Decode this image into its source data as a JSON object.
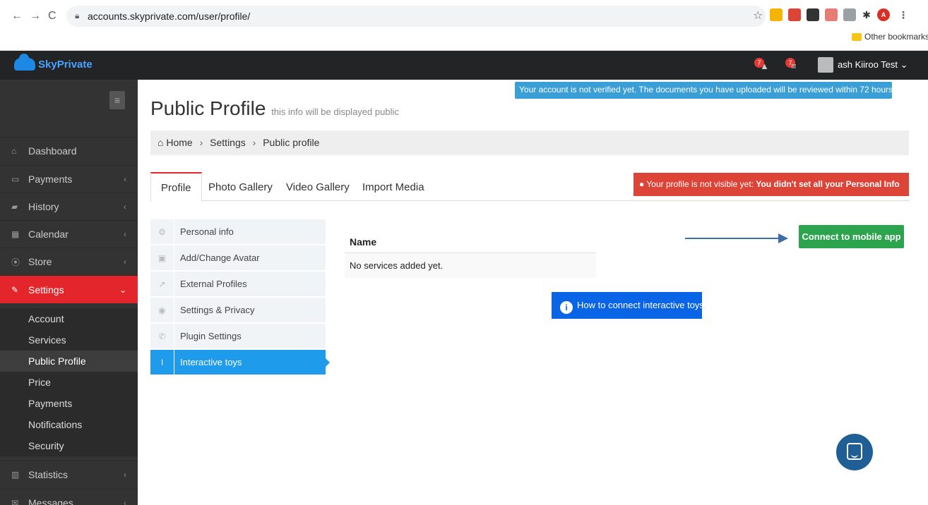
{
  "browser": {
    "back": "←",
    "forward": "→",
    "reload": "C",
    "url": "accounts.skyprivate.com/user/profile/",
    "bookmark_folder": "Other bookmarks",
    "profile_initial": "A"
  },
  "header": {
    "brand": "SkyPrivate",
    "notif1_count": "7",
    "notif2_count": "7",
    "user_name": "ash Kiiroo Test"
  },
  "sidebar": {
    "items": [
      {
        "label": "Dashboard",
        "icon": "home-icon"
      },
      {
        "label": "Payments",
        "icon": "money-icon"
      },
      {
        "label": "History",
        "icon": "book-icon"
      },
      {
        "label": "Calendar",
        "icon": "calendar-icon"
      },
      {
        "label": "Store",
        "icon": "play-circle-icon"
      },
      {
        "label": "Settings",
        "icon": "wrench-icon"
      },
      {
        "label": "Statistics",
        "icon": "bar-chart-icon"
      },
      {
        "label": "Messages",
        "icon": "envelope-icon"
      }
    ],
    "settings_sub": [
      "Account",
      "Services",
      "Public Profile",
      "Price",
      "Payments",
      "Notifications",
      "Security"
    ]
  },
  "notice": {
    "verify": "Your account is not verified yet. The documents you have uploaded will be reviewed within 72 hours.",
    "profile_prefix": "Your profile is not visible yet: ",
    "profile_bold": "You didn't set all your Personal Info"
  },
  "page": {
    "title": "Public Profile",
    "subtitle": "this info will be displayed public",
    "breadcrumb": [
      "Home",
      "Settings",
      "Public profile"
    ]
  },
  "tabs": [
    "Profile",
    "Photo Gallery",
    "Video Gallery",
    "Import Media"
  ],
  "subnav": [
    "Personal info",
    "Add/Change Avatar",
    "External Profiles",
    "Settings & Privacy",
    "Plugin Settings",
    "Interactive toys"
  ],
  "services": {
    "col_name": "Name",
    "empty": "No services added yet."
  },
  "actions": {
    "connect": "Connect to mobile app",
    "howto": "How to connect interactive toys"
  },
  "colors": {
    "accent_red": "#e3262b",
    "accent_blue": "#1e9bea",
    "success_green": "#2ca44e"
  }
}
